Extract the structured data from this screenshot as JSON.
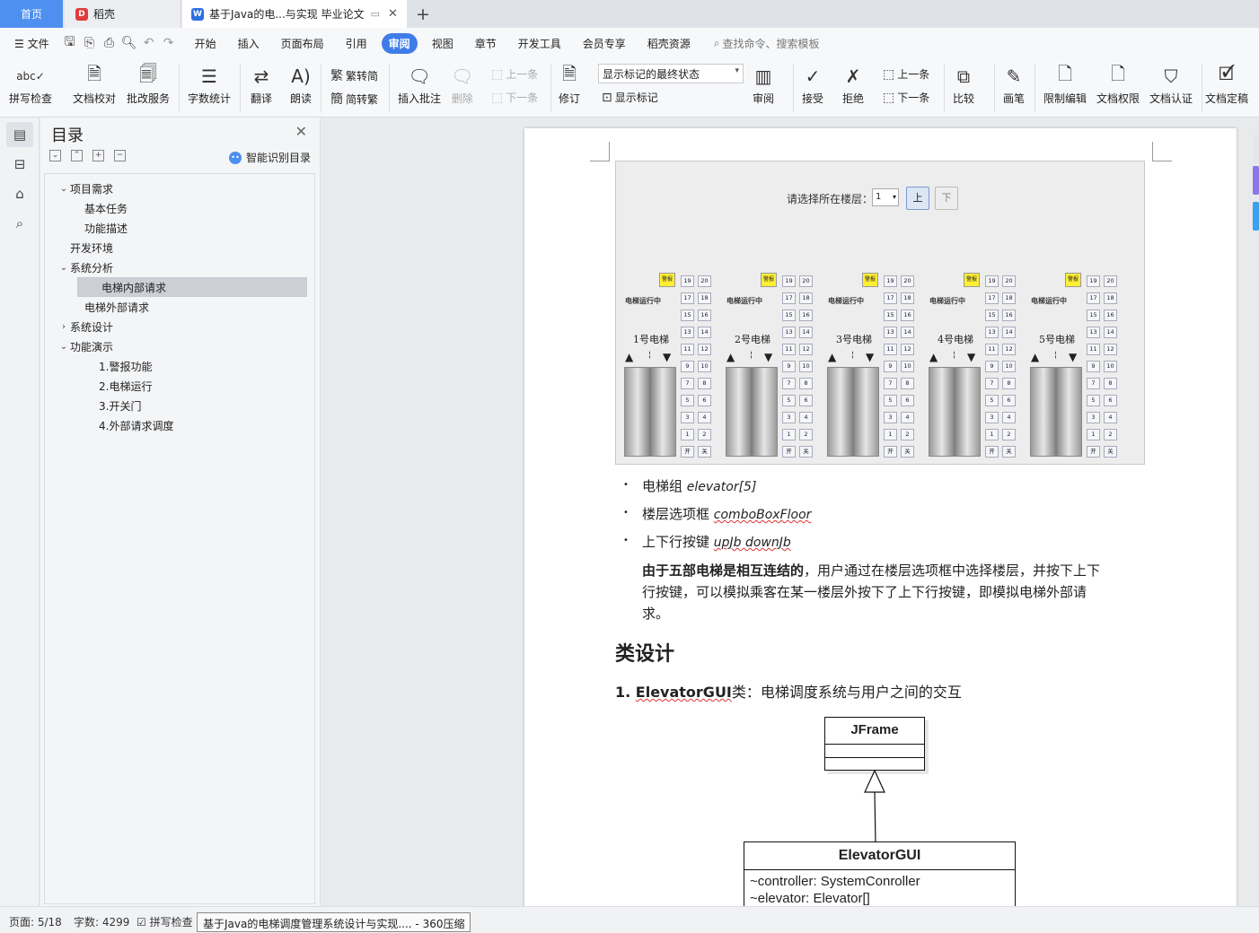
{
  "tabs": {
    "home": "首页",
    "daoke": "稻壳",
    "doc": "基于Java的电...与实现 毕业论文"
  },
  "menu": {
    "file": "文件",
    "items": [
      "开始",
      "插入",
      "页面布局",
      "引用",
      "审阅",
      "视图",
      "章节",
      "开发工具",
      "会员专享",
      "稻壳资源"
    ],
    "active": "审阅",
    "search_placeholder": "查找命令、搜索模板"
  },
  "ribbon": {
    "spell": "拼写检查",
    "proof": "文档校对",
    "review_service": "批改服务",
    "word_count": "字数统计",
    "translate": "翻译",
    "read_aloud": "朗读",
    "to_trad": "繁转简",
    "to_simp": "简转繁",
    "insert_comment": "插入批注",
    "delete": "删除",
    "prev": "上一条",
    "next": "下一条",
    "track": "修订",
    "display_select": "显示标记的最终状态",
    "show_marks": "显示标记",
    "review": "审阅",
    "accept": "接受",
    "reject": "拒绝",
    "prev2": "上一条",
    "next2": "下一条",
    "compare": "比较",
    "pen": "画笔",
    "restrict": "限制编辑",
    "permission": "文档权限",
    "certify": "文档认证",
    "finalize": "文档定稿"
  },
  "nav": {
    "title": "目录",
    "smart": "智能识别目录",
    "items": [
      {
        "label": "项目需求",
        "level": 1,
        "caret": "v"
      },
      {
        "label": "基本任务",
        "level": 2,
        "caret": ""
      },
      {
        "label": "功能描述",
        "level": 2,
        "caret": ""
      },
      {
        "label": "开发环境",
        "level": 1,
        "caret": ""
      },
      {
        "label": "系统分析",
        "level": 1,
        "caret": "v"
      },
      {
        "label": "电梯内部请求",
        "level": 2,
        "caret": "",
        "selected": true
      },
      {
        "label": "电梯外部请求",
        "level": 2,
        "caret": ""
      },
      {
        "label": "系统设计",
        "level": 1,
        "caret": ">"
      },
      {
        "label": "功能演示",
        "level": 1,
        "caret": "v"
      },
      {
        "label": "1.警报功能",
        "level": 3,
        "caret": ""
      },
      {
        "label": "2.电梯运行",
        "level": 3,
        "caret": ""
      },
      {
        "label": "3.开关门",
        "level": 3,
        "caret": ""
      },
      {
        "label": "4.外部请求调度",
        "level": 3,
        "caret": ""
      }
    ]
  },
  "elevator_gui": {
    "prompt": "请选择所在楼层：",
    "combo_value": "1",
    "up": "上",
    "down": "下",
    "alarm": "警报",
    "running": "电梯运行中",
    "names": [
      "1号电梯",
      "2号电梯",
      "3号电梯",
      "4号电梯",
      "5号电梯"
    ],
    "floor_pairs": [
      [
        "19",
        "20"
      ],
      [
        "17",
        "18"
      ],
      [
        "15",
        "16"
      ],
      [
        "13",
        "14"
      ],
      [
        "11",
        "12"
      ],
      [
        "9",
        "10"
      ],
      [
        "7",
        "8"
      ],
      [
        "5",
        "6"
      ],
      [
        "3",
        "4"
      ],
      [
        "1",
        "2"
      ],
      [
        "开",
        "关"
      ]
    ]
  },
  "doc": {
    "bullets": [
      {
        "label": "电梯组 ",
        "code": "elevator[5]"
      },
      {
        "label": "楼层选项框 ",
        "code": "comboBoxFloor"
      },
      {
        "label": "上下行按键 ",
        "code": "upJb downJb"
      }
    ],
    "para_bold": "由于五部电梯是相互连结的",
    "para_line1": "，用户通过在楼层选项框中选择楼层，并按下上下",
    "para_line2": "行按键，可以模拟乘客在某一楼层外按下了上下行按键，即模拟电梯外部请",
    "para_line3": "求。",
    "heading": "类设计",
    "class_num": "1. ",
    "class_name": "ElevatorGUI",
    "class_desc": "类：电梯调度系统与用户之间的交互",
    "uml_parent": "JFrame",
    "uml_child": "ElevatorGUI",
    "uml_attr1": "~controller: SystemConroller",
    "uml_attr2": "~elevator: Elevator[]"
  },
  "status": {
    "page": "页面: 5/18",
    "words": "字数: 4299",
    "spell": "拼写检查",
    "tooltip": "基于Java的电梯调度管理系统设计与实现.... - 360压缩"
  }
}
